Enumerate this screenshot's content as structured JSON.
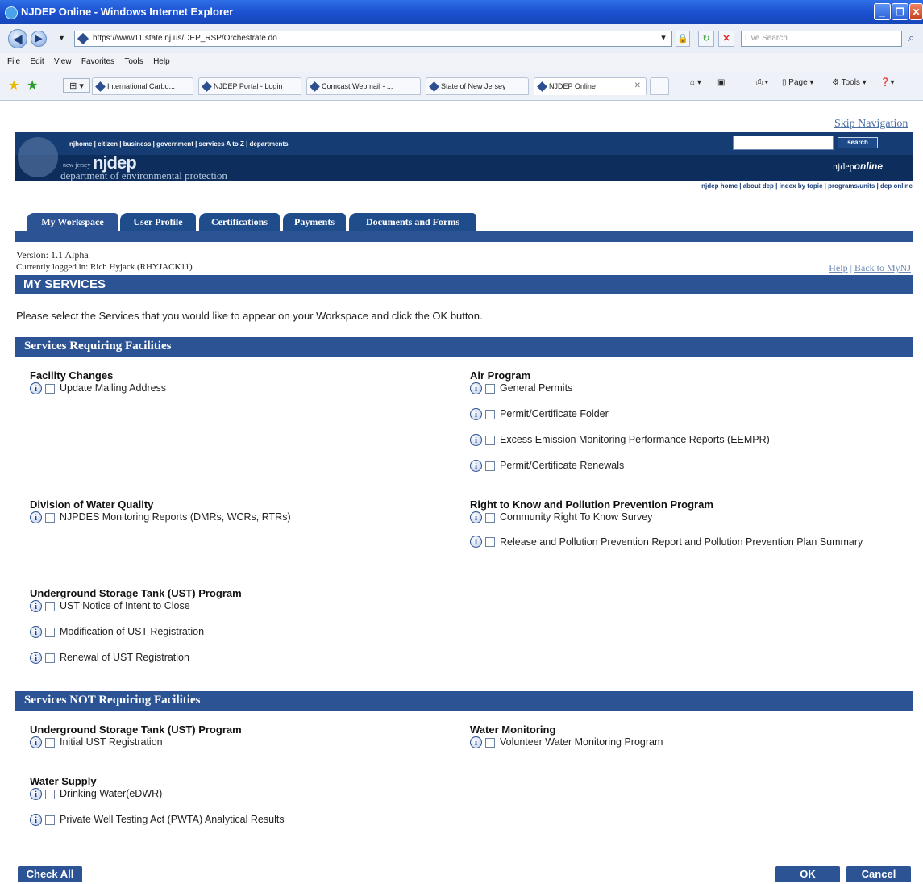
{
  "window": {
    "title": "NJDEP Online - Windows Internet Explorer"
  },
  "address": {
    "url": "https://www11.state.nj.us/DEP_RSP/Orchestrate.do",
    "live_search_placeholder": "Live Search"
  },
  "menu": [
    "File",
    "Edit",
    "View",
    "Favorites",
    "Tools",
    "Help"
  ],
  "browser_tabs": [
    {
      "label": "International Carbo..."
    },
    {
      "label": "NJDEP Portal - Login"
    },
    {
      "label": "Comcast Webmail - ..."
    },
    {
      "label": "State of New Jersey"
    },
    {
      "label": "NJDEP Online"
    }
  ],
  "commands": {
    "page": "Page ▾",
    "tools": "Tools ▾"
  },
  "page": {
    "skip_nav": "Skip Navigation",
    "banner": {
      "top_links": "njhome  |  citizen  |  business  |  government  |  services A to Z  |  departments",
      "logo_small": "new jersey",
      "logo": "njdep",
      "logo_sub": "department of environmental protection",
      "search_button": "search",
      "online_prefix": "njdep",
      "online_suffix": "online"
    },
    "sub_links": "njdep home  |  about dep  |  index by topic  |  programs/units  |  dep online",
    "tabs": [
      "My Workspace",
      "User Profile",
      "Certifications",
      "Payments",
      "Documents and Forms"
    ],
    "version": "Version: 1.1 Alpha",
    "logged_in": "Currently logged in: Rich Hyjack (RHYJACK11)",
    "help": "Help",
    "help_sep": " | ",
    "back": "Back to MyNJ",
    "my_services": "MY SERVICES",
    "instructions": "Please select the Services that you would like to appear on your Workspace and click the OK button.",
    "section_req": "Services Requiring Facilities",
    "section_notreq": "Services NOT Requiring Facilities",
    "req": {
      "facility_changes": {
        "title": "Facility Changes",
        "items": [
          "Update Mailing Address"
        ]
      },
      "air_program": {
        "title": "Air Program",
        "items": [
          "General Permits",
          "Permit/Certificate Folder",
          "Excess Emission Monitoring Performance Reports (EEMPR)",
          "Permit/Certificate Renewals"
        ]
      },
      "water_quality": {
        "title": "Division of Water Quality",
        "items": [
          "NJPDES Monitoring Reports (DMRs, WCRs, RTRs)"
        ]
      },
      "right_to_know": {
        "title": "Right to Know and Pollution Prevention Program",
        "items": [
          "Community Right To Know Survey",
          "Release and Pollution Prevention Report and Pollution Prevention Plan Summary"
        ]
      },
      "ust": {
        "title": "Underground Storage Tank (UST) Program",
        "items": [
          "UST Notice of Intent to Close",
          "Modification of UST Registration",
          "Renewal of UST Registration"
        ]
      }
    },
    "notreq": {
      "ust": {
        "title": "Underground Storage Tank (UST) Program",
        "items": [
          "Initial UST Registration"
        ]
      },
      "water_monitoring": {
        "title": "Water Monitoring",
        "items": [
          "Volunteer Water Monitoring Program"
        ]
      },
      "water_supply": {
        "title": "Water Supply",
        "items": [
          "Drinking Water(eDWR)",
          "Private Well Testing Act (PWTA) Analytical Results"
        ]
      }
    },
    "buttons": {
      "check_all": "Check All",
      "ok": "OK",
      "cancel": "Cancel"
    }
  }
}
